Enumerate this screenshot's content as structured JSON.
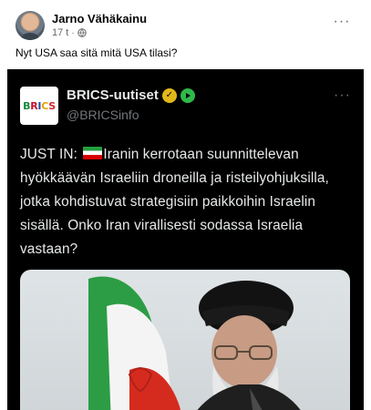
{
  "post": {
    "author": "Jarno Vähäkainu",
    "time": "17 t",
    "dot": "·",
    "text": "Nyt USA saa sitä mitä USA tilasi?",
    "more": "···"
  },
  "tweet": {
    "account_name": "BRICS-uutiset",
    "handle": "@BRICSinfo",
    "logo_text": "BRICS",
    "more": "···",
    "text_prefix": "JUST IN: ",
    "text_body": "Iranin kerrotaan suunnittelevan hyökkäävän Israeliin droneilla ja risteilyohjuksilla, jotka kohdistuvat strategisiin paikkoihin Israelin sisällä. Onko Iran virallisesti sodassa Israelia vastaan?"
  },
  "colors": {
    "tweet_bg": "#000000",
    "verified_badge": "#e2b719",
    "secondary_badge": "#2fb84a",
    "flag_green": "#239f40",
    "flag_red": "#da0000"
  }
}
